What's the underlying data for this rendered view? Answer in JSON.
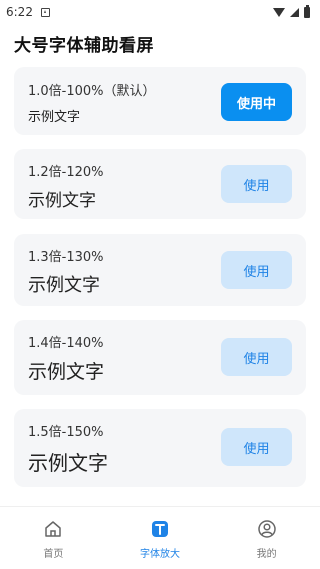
{
  "status_bar": {
    "time": "6:22"
  },
  "page": {
    "title": "大号字体辅助看屏"
  },
  "font_options": [
    {
      "scale_label": "1.0倍-100%（默认）",
      "sample_text": "示例文字",
      "button_label": "使用中",
      "active": true
    },
    {
      "scale_label": "1.2倍-120%",
      "sample_text": "示例文字",
      "button_label": "使用",
      "active": false
    },
    {
      "scale_label": "1.3倍-130%",
      "sample_text": "示例文字",
      "button_label": "使用",
      "active": false
    },
    {
      "scale_label": "1.4倍-140%",
      "sample_text": "示例文字",
      "button_label": "使用",
      "active": false
    },
    {
      "scale_label": "1.5倍-150%",
      "sample_text": "示例文字",
      "button_label": "使用",
      "active": false
    }
  ],
  "bottom_nav": {
    "items": [
      {
        "label": "首页",
        "icon": "home-icon",
        "active": false
      },
      {
        "label": "字体放大",
        "icon": "font-size-icon",
        "active": true
      },
      {
        "label": "我的",
        "icon": "profile-icon",
        "active": false
      }
    ]
  },
  "colors": {
    "accent": "#0a8ff0",
    "accent_light": "#cfe6fb",
    "card_bg": "#f5f6f8"
  }
}
